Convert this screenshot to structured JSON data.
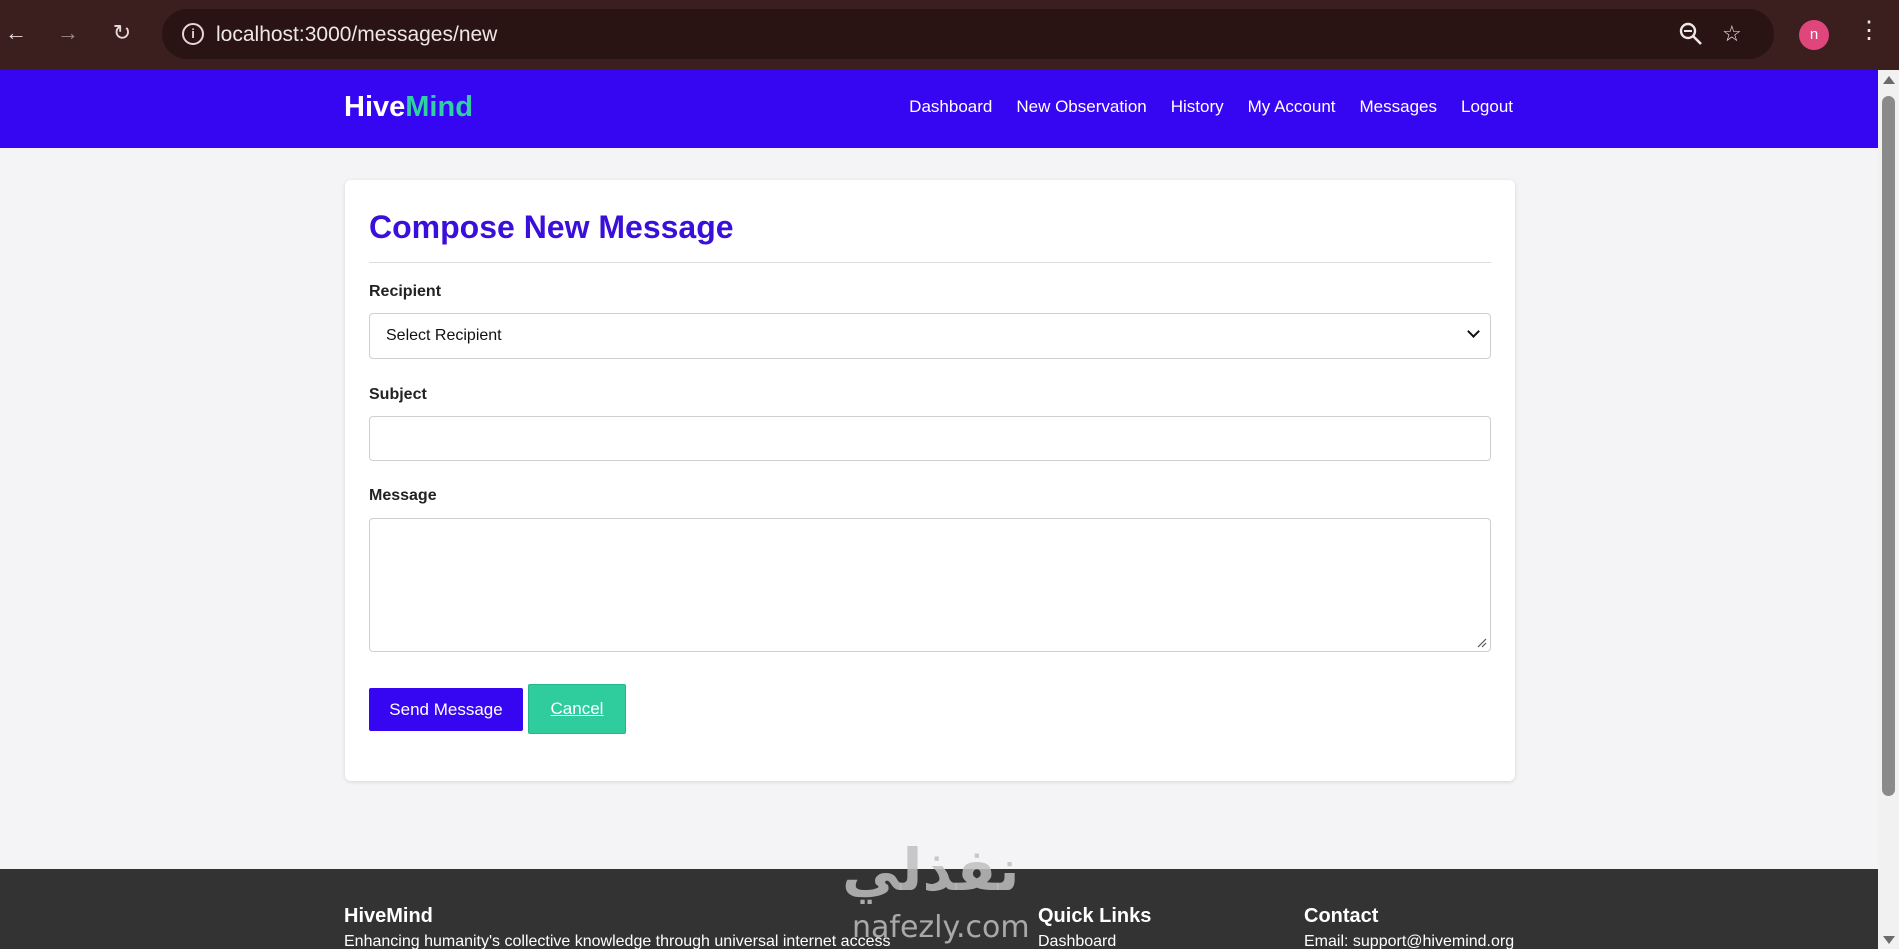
{
  "browser": {
    "url": "localhost:3000/messages/new",
    "avatar_letter": "n"
  },
  "header": {
    "logo_part1": "Hive",
    "logo_part2": "Mind",
    "nav": [
      "Dashboard",
      "New Observation",
      "History",
      "My Account",
      "Messages",
      "Logout"
    ]
  },
  "form": {
    "title": "Compose New Message",
    "recipient_label": "Recipient",
    "recipient_selected": "Select Recipient",
    "subject_label": "Subject",
    "subject_value": "",
    "message_label": "Message",
    "message_value": "",
    "send_label": "Send Message",
    "cancel_label": "Cancel"
  },
  "footer": {
    "brand_title": "HiveMind",
    "brand_text": "Enhancing humanity's collective knowledge through universal internet access",
    "links_title": "Quick Links",
    "links_first": "Dashboard",
    "contact_title": "Contact",
    "contact_email": "Email: support@hivemind.org"
  },
  "watermark": {
    "arabic": "نفذلي",
    "latin": "nafezly.com"
  },
  "colors": {
    "brand": "#3605f2",
    "accent": "#2fd1a3",
    "title": "#3a0fd9",
    "footer": "#333333"
  }
}
